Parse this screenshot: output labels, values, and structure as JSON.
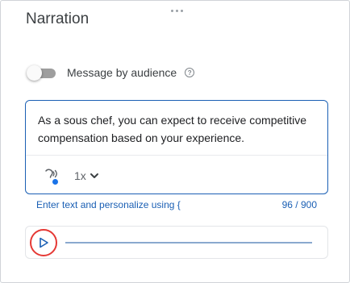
{
  "panel": {
    "title": "Narration"
  },
  "audience_toggle": {
    "label": "Message by audience",
    "enabled": false,
    "help_icon": "question-circle-icon"
  },
  "editor": {
    "text": "As a sous chef, you can expect to receive competitive compensation based on your experience.",
    "voice_icon": "voice-profile-icon",
    "speed_value": "1x",
    "speed_icon": "chevron-down-icon"
  },
  "hint": {
    "text": "Enter text and personalize using {",
    "char_count": "96 / 900"
  },
  "player": {
    "play_icon": "play-icon",
    "progress": 0
  },
  "colors": {
    "accent": "#1a5fb4",
    "highlight_ring": "#e53935",
    "status_dot": "#1a73e8"
  }
}
